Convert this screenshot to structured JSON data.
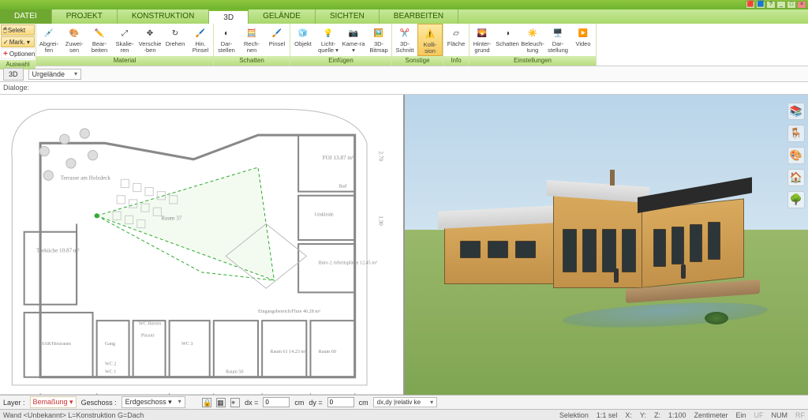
{
  "menu": {
    "file": "DATEI",
    "tabs": [
      "PROJEKT",
      "KONSTRUKTION",
      "3D",
      "GELÄNDE",
      "SICHTEN",
      "BEARBEITEN"
    ],
    "active": "3D"
  },
  "selcol": {
    "selekt": "Selekt",
    "mark": "Mark. ▾",
    "optionen": "Optionen"
  },
  "groups": {
    "auswahl": "Auswahl",
    "material": {
      "label": "Material",
      "tools": [
        "Abgrei-fen",
        "Zuwei-sen",
        "Bear-beiten",
        "Skalie-ren",
        "Verschie-ben",
        "Drehen",
        "Hin. Pinsel"
      ]
    },
    "schatten": {
      "label": "Schatten",
      "tools": [
        "Dar-stellen",
        "Rech-nen",
        "Pinsel"
      ]
    },
    "einfuegen": {
      "label": "Einfügen",
      "tools": [
        "Objekt",
        "Licht-quelle ▾",
        "Kame-ra ▾",
        "3D-Bitmap"
      ]
    },
    "sonstige": {
      "label": "Sonstige",
      "tools": [
        "3D-Schnitt",
        "Kolli-sion"
      ]
    },
    "info": {
      "label": "Info",
      "tools": [
        "Fläche"
      ]
    },
    "einstellungen": {
      "label": "Einstellungen",
      "tools": [
        "Hinter-grund",
        "Schatten",
        "Beleuch-tung",
        "Dar-stellung",
        "Video"
      ]
    }
  },
  "dock": {
    "tab": "3D",
    "select": "Urgelände"
  },
  "dialogs": "Dialoge:",
  "rooms": {
    "terrasse": "Terrasse\nam Holzdeck",
    "kueche": "Teeküche\n10.87 m²",
    "raum37": "Raum 37",
    "foj": "FOJ\n13.87 m²",
    "umk": "Umkleide",
    "bad": "Bad",
    "buero": "Büro\n2 Arbeitsplätze\n12.45 m²",
    "eingang": "Eingangsbereich/Flure\n46.28 m²",
    "har": "HAR/Heizraum",
    "gang": "Gang",
    "pissoir": "Pissoir",
    "wch": "WC Herren",
    "wc1": "WC 1",
    "wc2": "WC 2",
    "wc3": "WC 3",
    "raum50": "Raum 50",
    "raum61": "Raum 61\n14.23 m²",
    "raum60": "Raum 60"
  },
  "bottom": {
    "layer": "Layer :",
    "bemassung": "Bemaßung ▾",
    "geschoss": "Geschoss :",
    "erdgeschoss": "Erdgeschoss ▾",
    "dx": "dx =",
    "cm1": "cm",
    "dy": "dy =",
    "cm2": "cm",
    "rel": "dx,dy |relativ ke"
  },
  "status": {
    "left": "Wand <Unbekannt> L=Konstruktion G=Dach",
    "sel": "Selektion",
    "ratio": "1:1 sel",
    "x": "X:",
    "y": "Y:",
    "z": "Z:",
    "scale": "1:100",
    "unit": "Zentimeter",
    "ein": "Ein",
    "uf": "UF",
    "num": "NUM",
    "rf": "RF"
  }
}
